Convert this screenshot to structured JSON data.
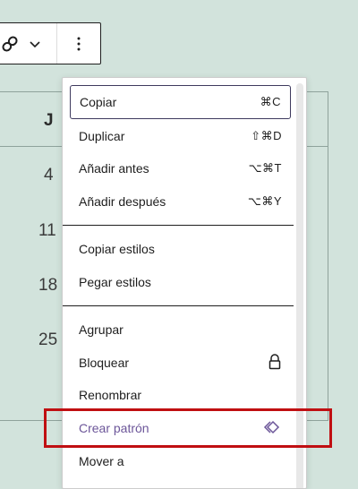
{
  "toolbar": {
    "link_icon": "link-icon",
    "chevron_icon": "chevron-down-icon",
    "more_icon": "more-vertical-icon"
  },
  "calendar": {
    "header": "J",
    "dates": [
      "4",
      "11",
      "18",
      "25"
    ]
  },
  "menu": {
    "group1": [
      {
        "label": "Copiar",
        "shortcut": "⌘C"
      },
      {
        "label": "Duplicar",
        "shortcut": "⇧⌘D"
      },
      {
        "label": "Añadir antes",
        "shortcut": "⌥⌘T"
      },
      {
        "label": "Añadir después",
        "shortcut": "⌥⌘Y"
      }
    ],
    "group2": [
      {
        "label": "Copiar estilos"
      },
      {
        "label": "Pegar estilos"
      }
    ],
    "group3": [
      {
        "label": "Agrupar"
      },
      {
        "label": "Bloquear",
        "icon": "lock-icon"
      },
      {
        "label": "Renombrar"
      },
      {
        "label": "Crear patrón",
        "icon": "pattern-symbol-icon"
      },
      {
        "label": "Mover a"
      }
    ]
  },
  "colors": {
    "background": "#d2e3dc",
    "highlight": "#c00f12",
    "accent": "#6c5699"
  }
}
